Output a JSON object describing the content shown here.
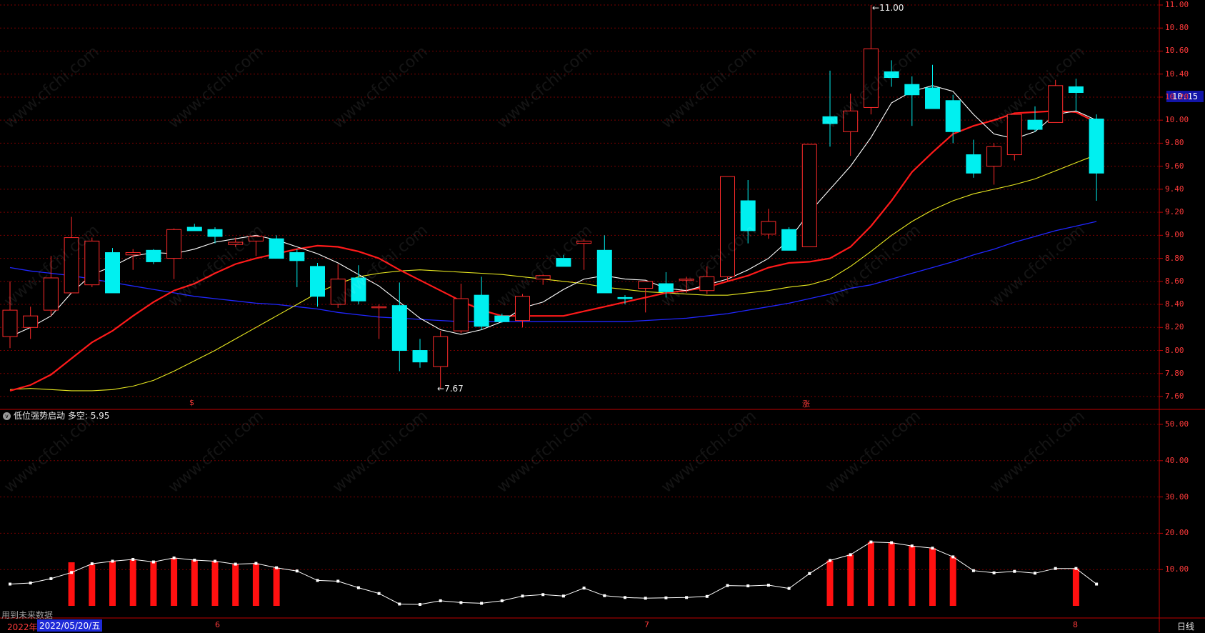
{
  "indicator": {
    "name": "低位强势启动",
    "field": "多空: 5.95",
    "note": "用到未来数据"
  },
  "footer": {
    "year": "2022年",
    "date": "2022/05/20/五",
    "period": "日线",
    "month_marks": [
      "6",
      "7",
      "8"
    ]
  },
  "current_price_label": "10.15",
  "annotations": {
    "high": "11.00",
    "low": "7.67"
  },
  "signal_marks": [
    "$",
    "涨"
  ],
  "watermark": "www.cfchi.com",
  "colors": {
    "up": "#ff2a2a",
    "down": "#00f0f0",
    "ma5": "#ffffff",
    "ma10": "#ff1a1a",
    "ma20": "#e8e820",
    "ma60": "#2026ff",
    "grid": "#7a0000",
    "axis": "#c00000"
  },
  "chart_data": [
    {
      "type": "candlestick",
      "title": "",
      "ylim": [
        7.5,
        11.0
      ],
      "yticks": [
        "11.00",
        "10.80",
        "10.60",
        "10.40",
        "10.20",
        "10.00",
        "9.80",
        "9.60",
        "9.40",
        "9.20",
        "9.00",
        "8.80",
        "8.60",
        "8.40",
        "8.20",
        "8.00",
        "7.80",
        "7.60"
      ],
      "ohlc": [
        [
          8.12,
          8.6,
          8.02,
          8.35
        ],
        [
          8.2,
          8.38,
          8.1,
          8.3
        ],
        [
          8.35,
          8.82,
          8.3,
          8.63
        ],
        [
          8.5,
          9.16,
          8.5,
          8.98
        ],
        [
          8.57,
          8.98,
          8.55,
          8.95
        ],
        [
          8.85,
          8.89,
          8.5,
          8.5
        ],
        [
          8.83,
          8.88,
          8.7,
          8.85
        ],
        [
          8.87,
          8.88,
          8.75,
          8.77
        ],
        [
          8.8,
          9.06,
          8.62,
          9.05
        ],
        [
          9.07,
          9.1,
          9.04,
          9.04
        ],
        [
          9.05,
          9.07,
          8.93,
          8.99
        ],
        [
          8.92,
          8.98,
          8.9,
          8.94
        ],
        [
          8.95,
          9.0,
          8.82,
          8.99
        ],
        [
          8.97,
          9.0,
          8.8,
          8.8
        ],
        [
          8.85,
          8.88,
          8.55,
          8.78
        ],
        [
          8.73,
          8.76,
          8.38,
          8.47
        ],
        [
          8.4,
          8.75,
          8.37,
          8.62
        ],
        [
          8.63,
          8.74,
          8.4,
          8.43
        ],
        [
          8.38,
          8.4,
          8.1,
          8.38
        ],
        [
          8.39,
          8.59,
          7.82,
          8.0
        ],
        [
          8.0,
          8.1,
          7.85,
          7.9
        ],
        [
          7.86,
          8.17,
          7.67,
          8.12
        ],
        [
          8.17,
          8.58,
          8.15,
          8.45
        ],
        [
          8.48,
          8.64,
          8.18,
          8.21
        ],
        [
          8.3,
          8.32,
          8.24,
          8.25
        ],
        [
          8.26,
          8.49,
          8.2,
          8.47
        ],
        [
          8.62,
          8.66,
          8.57,
          8.65
        ],
        [
          8.8,
          8.83,
          8.75,
          8.73
        ],
        [
          8.93,
          8.97,
          8.7,
          8.95
        ],
        [
          8.87,
          9.0,
          8.5,
          8.5
        ],
        [
          8.46,
          8.48,
          8.4,
          8.45
        ],
        [
          8.54,
          8.56,
          8.33,
          8.6
        ],
        [
          8.58,
          8.68,
          8.46,
          8.51
        ],
        [
          8.61,
          8.64,
          8.5,
          8.62
        ],
        [
          8.52,
          8.73,
          8.49,
          8.64
        ],
        [
          8.64,
          9.4,
          8.6,
          9.51
        ],
        [
          9.3,
          9.48,
          8.93,
          9.04
        ],
        [
          9.01,
          9.23,
          8.97,
          9.12
        ],
        [
          9.05,
          9.07,
          8.87,
          8.87
        ],
        [
          8.9,
          9.79,
          8.9,
          9.79
        ],
        [
          10.03,
          10.43,
          9.77,
          9.97
        ],
        [
          9.9,
          10.23,
          9.69,
          10.08
        ],
        [
          10.11,
          11.0,
          10.05,
          10.62
        ],
        [
          10.42,
          10.52,
          10.29,
          10.37
        ],
        [
          10.31,
          10.38,
          9.95,
          10.22
        ],
        [
          10.28,
          10.48,
          10.12,
          10.1
        ],
        [
          10.17,
          10.22,
          9.8,
          9.9
        ],
        [
          9.7,
          9.83,
          9.5,
          9.54
        ],
        [
          9.6,
          9.8,
          9.44,
          9.77
        ],
        [
          9.7,
          10.06,
          9.65,
          10.05
        ],
        [
          10.0,
          10.12,
          9.9,
          9.92
        ],
        [
          9.98,
          10.35,
          10.0,
          10.3
        ],
        [
          10.29,
          10.36,
          10.07,
          10.24
        ],
        [
          10.01,
          10.05,
          9.3,
          9.54
        ]
      ],
      "ma5": [
        8.12,
        8.2,
        8.3,
        8.5,
        8.66,
        8.73,
        8.82,
        8.85,
        8.84,
        8.88,
        8.94,
        8.97,
        9.0,
        8.96,
        8.9,
        8.84,
        8.76,
        8.66,
        8.56,
        8.42,
        8.28,
        8.18,
        8.14,
        8.18,
        8.25,
        8.37,
        8.42,
        8.53,
        8.62,
        8.65,
        8.62,
        8.61,
        8.54,
        8.52,
        8.57,
        8.62,
        8.7,
        8.8,
        8.96,
        9.2,
        9.4,
        9.6,
        9.85,
        10.15,
        10.25,
        10.3,
        10.25,
        10.05,
        9.88,
        9.84,
        9.9,
        10.05,
        10.08,
        10.0
      ],
      "ma10": [
        7.65,
        7.7,
        7.79,
        7.93,
        8.07,
        8.17,
        8.3,
        8.42,
        8.52,
        8.58,
        8.67,
        8.75,
        8.8,
        8.84,
        8.88,
        8.91,
        8.9,
        8.86,
        8.8,
        8.7,
        8.61,
        8.52,
        8.43,
        8.35,
        8.3,
        8.3,
        8.3,
        8.3,
        8.34,
        8.38,
        8.42,
        8.46,
        8.5,
        8.52,
        8.55,
        8.6,
        8.65,
        8.72,
        8.76,
        8.77,
        8.8,
        8.9,
        9.08,
        9.3,
        9.55,
        9.72,
        9.88,
        9.95,
        10.0,
        10.06,
        10.07,
        10.08,
        10.07,
        9.98
      ],
      "ma20": [
        7.66,
        7.67,
        7.66,
        7.65,
        7.65,
        7.66,
        7.69,
        7.74,
        7.82,
        7.91,
        8.0,
        8.1,
        8.2,
        8.3,
        8.4,
        8.5,
        8.58,
        8.64,
        8.67,
        8.69,
        8.7,
        8.69,
        8.68,
        8.67,
        8.66,
        8.64,
        8.62,
        8.6,
        8.58,
        8.55,
        8.53,
        8.51,
        8.5,
        8.49,
        8.48,
        8.48,
        8.5,
        8.52,
        8.55,
        8.57,
        8.62,
        8.73,
        8.86,
        9.0,
        9.12,
        9.22,
        9.3,
        9.36,
        9.4,
        9.44,
        9.49,
        9.56,
        9.63,
        9.7
      ],
      "ma60": [
        8.72,
        8.69,
        8.67,
        8.65,
        8.62,
        8.59,
        8.56,
        8.53,
        8.5,
        8.47,
        8.45,
        8.43,
        8.41,
        8.4,
        8.38,
        8.36,
        8.33,
        8.31,
        8.29,
        8.28,
        8.27,
        8.26,
        8.25,
        8.25,
        8.25,
        8.25,
        8.25,
        8.25,
        8.25,
        8.25,
        8.25,
        8.26,
        8.27,
        8.28,
        8.3,
        8.32,
        8.35,
        8.38,
        8.41,
        8.45,
        8.49,
        8.54,
        8.57,
        8.62,
        8.67,
        8.72,
        8.77,
        8.83,
        8.88,
        8.94,
        8.99,
        9.04,
        9.08,
        9.12
      ]
    },
    {
      "type": "bar",
      "title": "低位强势启动",
      "ylim": [
        0,
        55
      ],
      "yticks": [
        "50.00",
        "40.00",
        "30.00",
        "20.00",
        "10.00"
      ],
      "series": [
        {
          "name": "",
          "type": "bar",
          "values": [
            null,
            null,
            null,
            12,
            11.4,
            12.3,
            12.8,
            12.1,
            13.2,
            12.6,
            12.3,
            11.5,
            11.7,
            10.5,
            null,
            null,
            null,
            null,
            null,
            null,
            null,
            null,
            null,
            null,
            null,
            null,
            null,
            null,
            null,
            null,
            null,
            null,
            null,
            null,
            null,
            null,
            null,
            null,
            null,
            null,
            12.5,
            14.1,
            17.6,
            17.4,
            16.5,
            15.9,
            13.5,
            null,
            null,
            null,
            null,
            null,
            10.3,
            null
          ]
        },
        {
          "name": "",
          "type": "line",
          "values": [
            6.0,
            6.3,
            7.5,
            9.2,
            11.6,
            12.3,
            12.8,
            12.1,
            13.2,
            12.6,
            12.3,
            11.5,
            11.7,
            10.5,
            9.6,
            7.0,
            6.8,
            5.0,
            3.4,
            0.5,
            0.4,
            1.4,
            0.9,
            0.7,
            1.4,
            2.7,
            3.1,
            2.7,
            4.9,
            2.8,
            2.3,
            2.1,
            2.2,
            2.3,
            2.6,
            5.6,
            5.5,
            5.7,
            4.8,
            8.9,
            12.5,
            14.1,
            17.6,
            17.4,
            16.5,
            15.9,
            13.5,
            9.7,
            9.1,
            9.5,
            9.0,
            10.3,
            10.3,
            6.0
          ]
        }
      ]
    }
  ]
}
